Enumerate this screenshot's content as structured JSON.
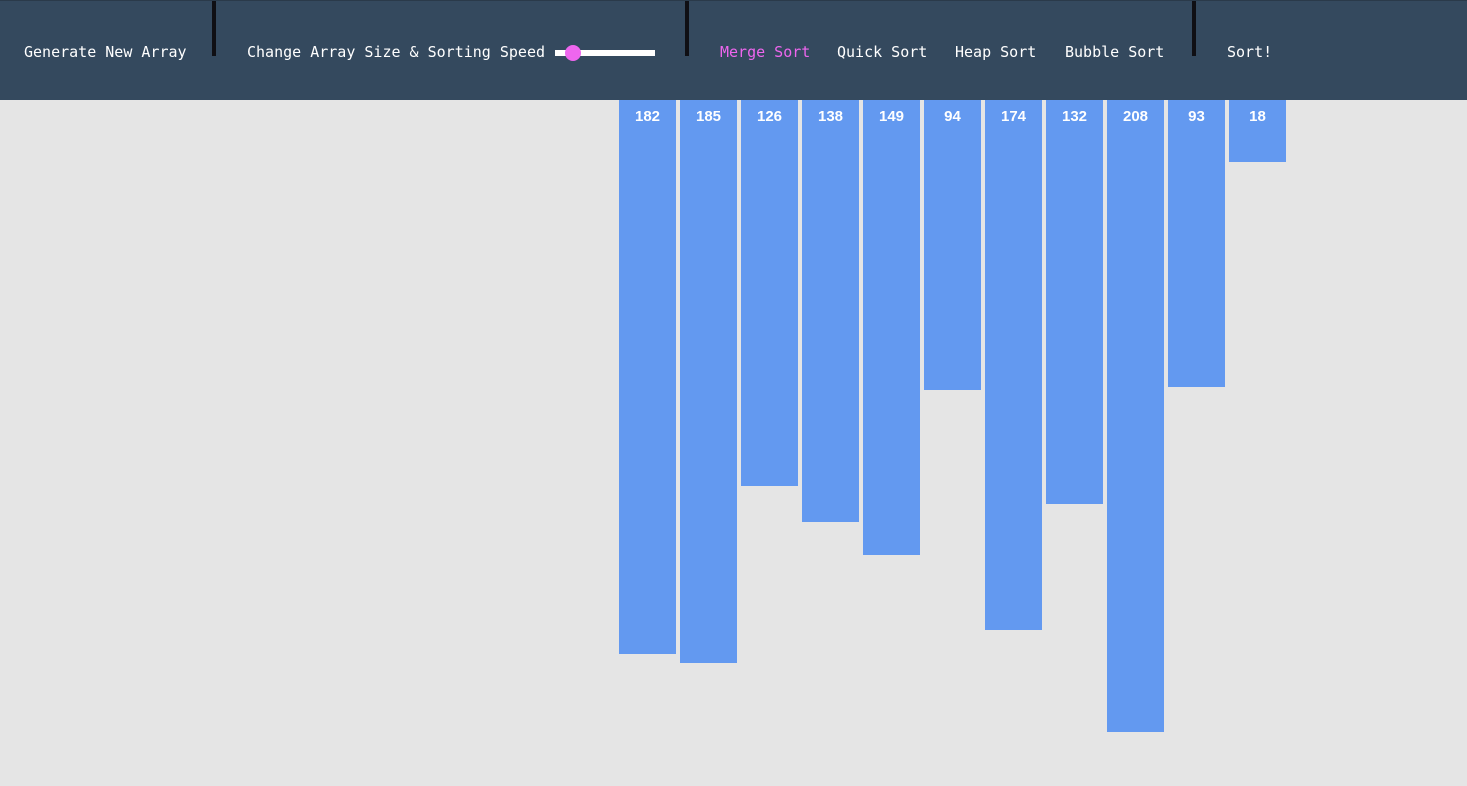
{
  "navbar": {
    "generate_label": "Generate New Array",
    "size_speed_label": "Change Array Size & Sorting Speed",
    "slider": {
      "min": 0,
      "max": 100,
      "value": 12
    },
    "algorithms": [
      {
        "label": "Merge Sort",
        "active": true
      },
      {
        "label": "Quick Sort",
        "active": false
      },
      {
        "label": "Heap Sort",
        "active": false
      },
      {
        "label": "Bubble Sort",
        "active": false
      }
    ],
    "sort_label": "Sort!"
  },
  "array": {
    "values": [
      182,
      185,
      126,
      138,
      149,
      94,
      174,
      132,
      208,
      93,
      18
    ]
  },
  "colors": {
    "navbar_bg": "#34495e",
    "bar": "#6399f0",
    "accent": "#ee66ee",
    "background": "#e5e5e5"
  }
}
